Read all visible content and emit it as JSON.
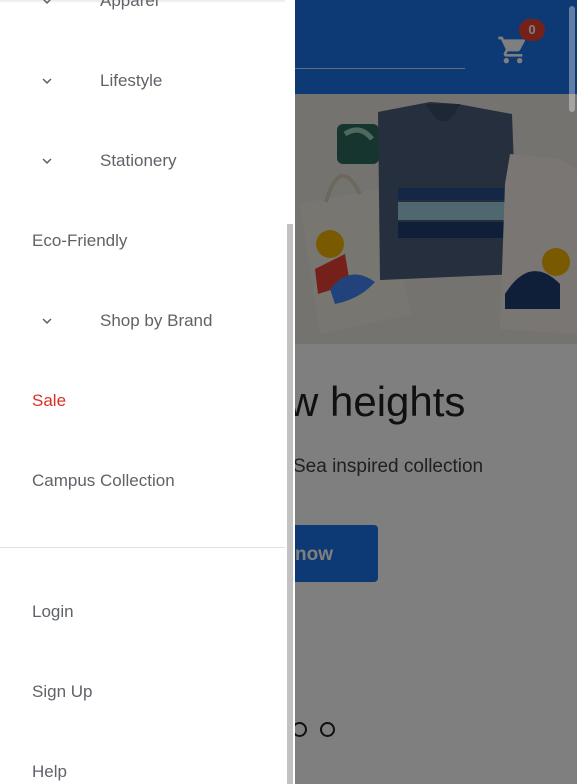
{
  "header": {
    "cart_count": "0",
    "cart_icon": "shopping-cart-icon",
    "colors": {
      "topbar": "#1a73e8",
      "badge": "#ea4335"
    }
  },
  "hero": {
    "headline": "w heights",
    "subline": "Sea inspired collection",
    "cta_label": "now"
  },
  "carousel": {
    "dots": 2
  },
  "drawer": {
    "categories": [
      {
        "label": "Apparel",
        "expandable": true
      },
      {
        "label": "Lifestyle",
        "expandable": true
      },
      {
        "label": "Stationery",
        "expandable": true
      },
      {
        "label": "Eco-Friendly",
        "expandable": false
      },
      {
        "label": "Shop by Brand",
        "expandable": true
      },
      {
        "label": "Sale",
        "expandable": false,
        "color": "#d93025"
      },
      {
        "label": "Campus Collection",
        "expandable": false
      }
    ],
    "account": [
      {
        "label": "Login"
      },
      {
        "label": "Sign Up"
      },
      {
        "label": "Help"
      }
    ]
  }
}
